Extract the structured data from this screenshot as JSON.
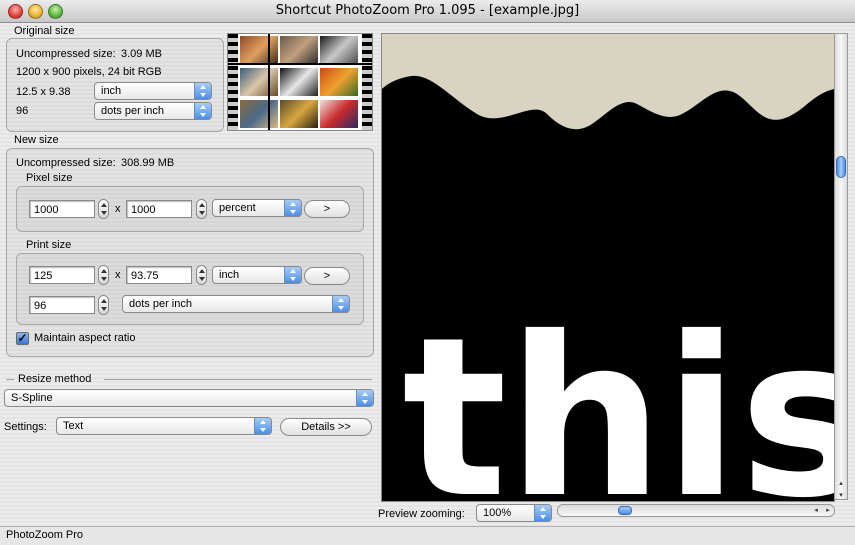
{
  "window": {
    "title": "Shortcut PhotoZoom Pro 1.095 - [example.jpg]"
  },
  "original": {
    "heading": "Original size",
    "uncompressed_label": "Uncompressed size:",
    "uncompressed_value": "3.09 MB",
    "dimensions": "1200 x 900 pixels, 24 bit RGB",
    "print_size": "12.5 x 9.38",
    "print_unit": "inch",
    "resolution": "96",
    "resolution_unit": "dots per inch"
  },
  "new_size": {
    "heading": "New size",
    "uncompressed_label": "Uncompressed size:",
    "uncompressed_value": "308.99 MB",
    "pixel_size": {
      "heading": "Pixel size",
      "width": "1000",
      "separator": "x",
      "height": "1000",
      "unit": "percent",
      "arrow_button": ">"
    },
    "print_size": {
      "heading": "Print size",
      "width": "125",
      "separator": "x",
      "height": "93.75",
      "unit": "inch",
      "arrow_button": ">",
      "resolution": "96",
      "resolution_unit": "dots per inch"
    },
    "maintain_aspect": {
      "label": "Maintain aspect ratio",
      "checked": true,
      "mark": "✓"
    }
  },
  "resize": {
    "heading": "Resize method",
    "method": "S-Spline",
    "settings_label": "Settings:",
    "settings_value": "Text",
    "details_button": "Details >>"
  },
  "preview": {
    "zoom_label": "Preview zooming:",
    "zoom_value": "100%",
    "text": "this",
    "horizontal_scroll_fraction": 0.25,
    "vertical_scroll_fraction": 0.27,
    "scroll_left": "◂",
    "scroll_right": "▸",
    "scroll_up": "▴",
    "scroll_down": "▾"
  },
  "status": {
    "text": "PhotoZoom Pro"
  },
  "colors": {
    "accent": "#4b8ee6",
    "preview_bg": "#000000",
    "sky": "#d9d3c2"
  }
}
